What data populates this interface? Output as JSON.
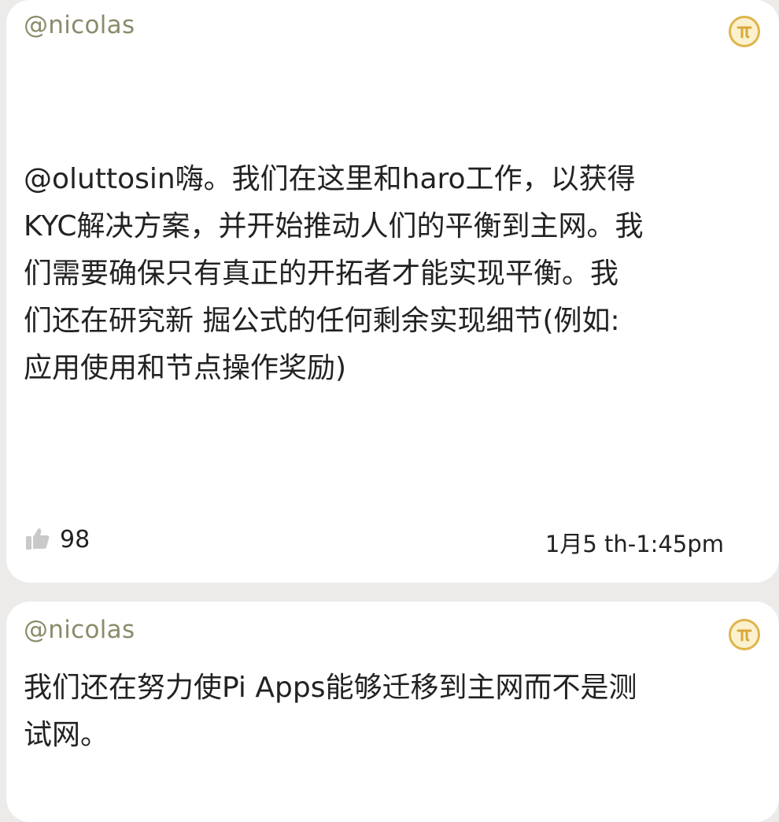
{
  "posts": [
    {
      "author": "@nicolas",
      "body": "@oluttosin嗨。我们在这里和haro工作，以获得\nKYC解决方案，并开始推动人们的平衡到主网。我\n们需要确保只有真正的开拓者才能实现平衡。我\n们还在研究新 掘公式的任何剩余实现细节(例如:\n应用使用和节点操作奖励)",
      "likes": "98",
      "timestamp": "1月5 th-1:45pm",
      "badge_icon": "pi-coin-icon",
      "like_icon": "thumbs-up-icon"
    },
    {
      "author": "@nicolas",
      "body": "我们还在努力使Pi Apps能够迁移到主网而不是测\n试网。",
      "badge_icon": "pi-coin-icon"
    }
  ],
  "colors": {
    "background": "#ecebea",
    "card": "#ffffff",
    "author": "#8b8b6a",
    "badge_border": "#e0b44a",
    "badge_fill": "#fbf1cf"
  }
}
